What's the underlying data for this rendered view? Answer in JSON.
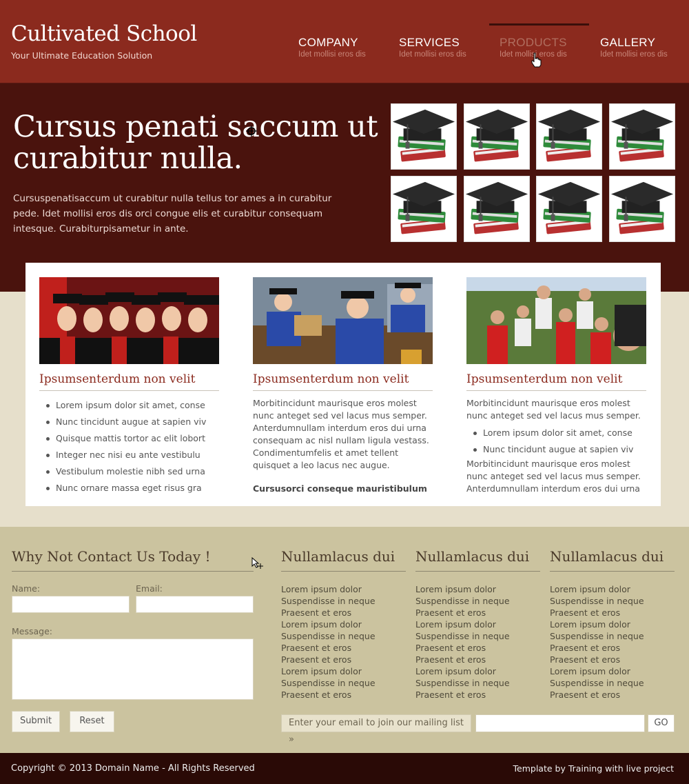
{
  "header": {
    "title": "Cultivated School",
    "tagline": "Your Ultimate Education Solution",
    "nav": [
      {
        "label": "COMPANY",
        "sub": "Idet mollisi eros dis"
      },
      {
        "label": "SERVICES",
        "sub": "Idet mollisi eros dis"
      },
      {
        "label": "PRODUCTS",
        "sub": "Idet mollisi eros dis"
      },
      {
        "label": "GALLERY",
        "sub": "Idet mollisi eros dis"
      }
    ],
    "colors": {
      "header_bg": "#8b2a1e",
      "hero_bg": "#4a130d",
      "accent": "#8b2a1e"
    }
  },
  "hero": {
    "title": "Cursus penati saccum ut curabitur nulla.",
    "text": "Cursuspenatisaccum ut curabitur nulla tellus tor ames a in curabitur pede. Idet mollisi eros dis orci congue elis et curabitur consequam intesque. Curabiturpisametur in ante.",
    "thumbnails_icon": "graduation-cap-books-icon"
  },
  "columns": [
    {
      "title": "Ipsumsenterdum non velit",
      "photo": "graduates-photo",
      "items": [
        "Lorem ipsum dolor sit amet, conse",
        "Nunc tincidunt augue at sapien viv",
        "Quisque mattis tortor ac elit lobort",
        "Integer nec nisi eu ante vestibulu",
        "Vestibulum molestie nibh sed urna",
        "Nunc ornare massa eget risus gra"
      ]
    },
    {
      "title": "Ipsumsenterdum non velit",
      "photo": "students-studying-photo",
      "text": "Morbitincidunt maurisque eros molest nunc anteget sed vel lacus mus semper. Anterdumnullam interdum eros dui urna consequam ac nisl nullam ligula vestass. Condimentumfelis et amet tellent quisquet a leo lacus nec augue.",
      "strong": "Cursusorci conseque mauristibulum"
    },
    {
      "title": "Ipsumsenterdum non velit",
      "photo": "crowd-event-photo",
      "text1": "Morbitincidunt maurisque eros molest nunc anteget sed vel lacus mus semper.",
      "items": [
        "Lorem ipsum dolor sit amet, conse",
        "Nunc tincidunt augue at sapien viv"
      ],
      "text2": "Morbitincidunt maurisque eros molest nunc anteget sed vel lacus mus semper. Anterdumnullam interdum eros dui urna"
    }
  ],
  "contact": {
    "title": "Why Not Contact Us Today !",
    "name_label": "Name:",
    "email_label": "Email:",
    "message_label": "Message:",
    "submit": "Submit",
    "reset": "Reset"
  },
  "link_columns": [
    {
      "title": "Nullamlacus dui",
      "items": [
        "Lorem ipsum dolor",
        "Suspendisse in neque",
        "Praesent et eros",
        "Lorem ipsum dolor",
        "Suspendisse in neque",
        "Praesent et eros",
        "Praesent et eros",
        "Lorem ipsum dolor",
        "Suspendisse in neque",
        "Praesent et eros"
      ]
    },
    {
      "title": "Nullamlacus dui",
      "items": [
        "Lorem ipsum dolor",
        "Suspendisse in neque",
        "Praesent et eros",
        "Lorem ipsum dolor",
        "Suspendisse in neque",
        "Praesent et eros",
        "Praesent et eros",
        "Lorem ipsum dolor",
        "Suspendisse in neque",
        "Praesent et eros"
      ]
    },
    {
      "title": "Nullamlacus dui",
      "items": [
        "Lorem ipsum dolor",
        "Suspendisse in neque",
        "Praesent et eros",
        "Lorem ipsum dolor",
        "Suspendisse in neque",
        "Praesent et eros",
        "Praesent et eros",
        "Lorem ipsum dolor",
        "Suspendisse in neque",
        "Praesent et eros"
      ]
    }
  ],
  "newsletter": {
    "label": "Enter your email to join our mailing list »",
    "go": "GO"
  },
  "footer": {
    "copyright": "Copyright © 2013 Domain Name - All Rights Reserved",
    "credit": "Template by Training with live project"
  }
}
